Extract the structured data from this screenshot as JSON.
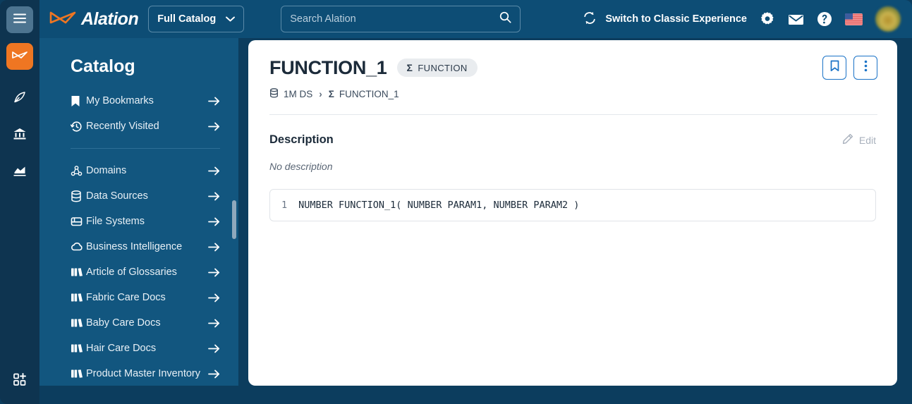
{
  "rail": {
    "items": [
      {
        "name": "menu-toggle",
        "icon": "hamburger-icon"
      },
      {
        "name": "alation-logo",
        "icon": "alation-bowtie-icon"
      },
      {
        "name": "stewardship",
        "icon": "quill-pen-icon"
      },
      {
        "name": "governance",
        "icon": "bank-building-icon"
      },
      {
        "name": "analytics",
        "icon": "area-chart-icon"
      },
      {
        "name": "add-app",
        "icon": "grid-plus-icon"
      }
    ]
  },
  "header": {
    "brand": "Alation",
    "catalog_select": "Full Catalog",
    "chevron": "chevron-down-icon",
    "search": {
      "placeholder": "Search Alation",
      "value": "",
      "icon": "search-icon"
    },
    "switch_experience": "Switch to Classic Experience",
    "switch_icon": "refresh-cycle-icon",
    "icons": [
      "gear-icon",
      "envelope-icon",
      "question-circle-icon",
      "us-flag-icon",
      "user-avatar"
    ]
  },
  "sidebar": {
    "title": "Catalog",
    "group1": [
      {
        "label": "My Bookmarks",
        "icon": "bookmark-icon"
      },
      {
        "label": "Recently Visited",
        "icon": "history-clock-icon"
      }
    ],
    "group2": [
      {
        "label": "Domains",
        "icon": "domains-icon"
      },
      {
        "label": "Data Sources",
        "icon": "database-icon"
      },
      {
        "label": "File Systems",
        "icon": "file-system-icon"
      },
      {
        "label": "Business Intelligence",
        "icon": "cloud-icon"
      },
      {
        "label": "Article of Glossaries",
        "icon": "books-icon"
      },
      {
        "label": "Fabric Care Docs",
        "icon": "books-icon"
      },
      {
        "label": "Baby Care Docs",
        "icon": "books-icon"
      },
      {
        "label": "Hair Care Docs",
        "icon": "books-icon"
      },
      {
        "label": "Product Master Inventory",
        "icon": "books-icon"
      }
    ],
    "arrow_icon": "arrow-right-icon"
  },
  "main": {
    "title": "FUNCTION_1",
    "badge": {
      "symbol": "Σ",
      "label": "FUNCTION"
    },
    "breadcrumb": {
      "source": "1M DS",
      "source_icon": "database-icon",
      "separator": "›",
      "current": "FUNCTION_1",
      "current_symbol": "Σ"
    },
    "actions": [
      {
        "name": "bookmark-button",
        "icon": "bookmark-outline-icon"
      },
      {
        "name": "more-options-button",
        "icon": "kebab-menu-icon"
      }
    ],
    "description": {
      "heading": "Description",
      "edit_label": "Edit",
      "edit_icon": "pencil-icon",
      "empty_text": "No description"
    },
    "code": {
      "lines": [
        {
          "number": "1",
          "text": "NUMBER FUNCTION_1( NUMBER PARAM1, NUMBER PARAM2 )"
        }
      ]
    }
  },
  "colors": {
    "page_bg": "#0c3d5e",
    "rail_bg": "#0e3450",
    "header_bg": "#0d4d75",
    "sidebar_bg": "#12567f",
    "brand_orange": "#ef7622",
    "accent_blue": "#1b73c7",
    "panel_white": "#ffffff"
  }
}
